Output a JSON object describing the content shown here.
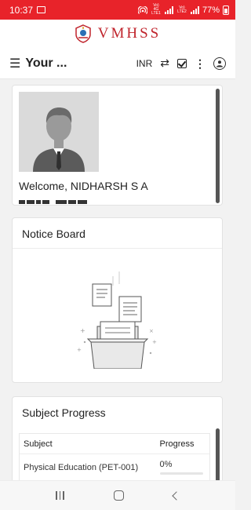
{
  "status_bar": {
    "time": "10:37",
    "net1": "Vo) 4G LTE1",
    "net2": "Vo) LTE2",
    "battery": "77%"
  },
  "brand": {
    "name": "VMHSS"
  },
  "appbar": {
    "title": "Your ...",
    "currency": "INR"
  },
  "profile": {
    "welcome": "Welcome, NIDHARSH S A"
  },
  "notice_board": {
    "title": "Notice Board"
  },
  "subject_progress": {
    "title": "Subject Progress",
    "columns": [
      "Subject",
      "Progress"
    ],
    "rows": [
      {
        "subject": "Physical Education (PET-001)",
        "progress": "0%",
        "fraction": 0
      }
    ]
  },
  "colors": {
    "accent": "#e8232a",
    "brand": "#c0242c"
  },
  "icons": [
    "gallery-icon",
    "hamburger-icon",
    "swap-icon",
    "checkbox-icon",
    "more-vert-icon",
    "account-icon",
    "recent-apps-icon",
    "home-icon",
    "back-icon"
  ]
}
